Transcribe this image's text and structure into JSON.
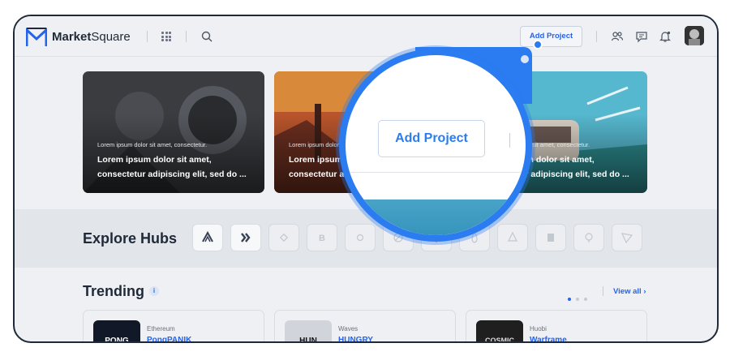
{
  "header": {
    "brand_bold": "Market",
    "brand_rest": "Square",
    "add_project_label": "Add Project"
  },
  "icons": [
    "logo-icon",
    "apps-grid-icon",
    "search-icon",
    "users-icon",
    "chat-icon",
    "bell-icon",
    "avatar"
  ],
  "featured": [
    {
      "small": "Lorem ipsum dolor sit amet, consectetur.",
      "line1": "Lorem ipsum dolor sit amet,",
      "line2": "consectetur adipiscing elit, sed do ...",
      "color_top": "#3a3c40",
      "color_bottom": "#1e1f22"
    },
    {
      "small": "Lorem ipsum dolor sit amet, consectetur.",
      "line1": "Lorem ipsum dolor sit amet,",
      "line2": "consectetur adipiscing elit, sed do ...",
      "color_top": "#c0532a",
      "color_bottom": "#5a2c1f"
    },
    {
      "small": "Lorem ipsum dolor sit amet, consectetur.",
      "line1": "Lorem ipsum dolor sit amet,",
      "line2": "consectetur adipiscing elit, sed do ...",
      "color_top": "#4bb3c9",
      "color_bottom": "#2c7f86"
    }
  ],
  "explore": {
    "title": "Explore Hubs",
    "hubs": [
      "arweave",
      "hive",
      "binance",
      "bitcoin",
      "generic",
      "polygon",
      "ethereum",
      "flow",
      "tezos",
      "huobi",
      "pepe",
      "tron"
    ]
  },
  "trending": {
    "title": "Trending",
    "info": "i",
    "view_all": "View all ›",
    "items": [
      {
        "chain": "Ethereum",
        "name": "PongPANIK",
        "thumb_text": "PONG",
        "thumb_color": "#111827"
      },
      {
        "chain": "Waves",
        "name": "HUNGRY",
        "thumb_text": "HUN",
        "thumb_color": "#d1d5db"
      },
      {
        "chain": "Huobi",
        "name": "Warframe",
        "thumb_text": "COSMIC",
        "thumb_color": "#1f1f1f"
      }
    ]
  },
  "magnifier": {
    "button_label": "Add Project"
  },
  "colors": {
    "accent": "#2b7cf0",
    "link": "#2563eb",
    "text_dark": "#1f2937"
  }
}
